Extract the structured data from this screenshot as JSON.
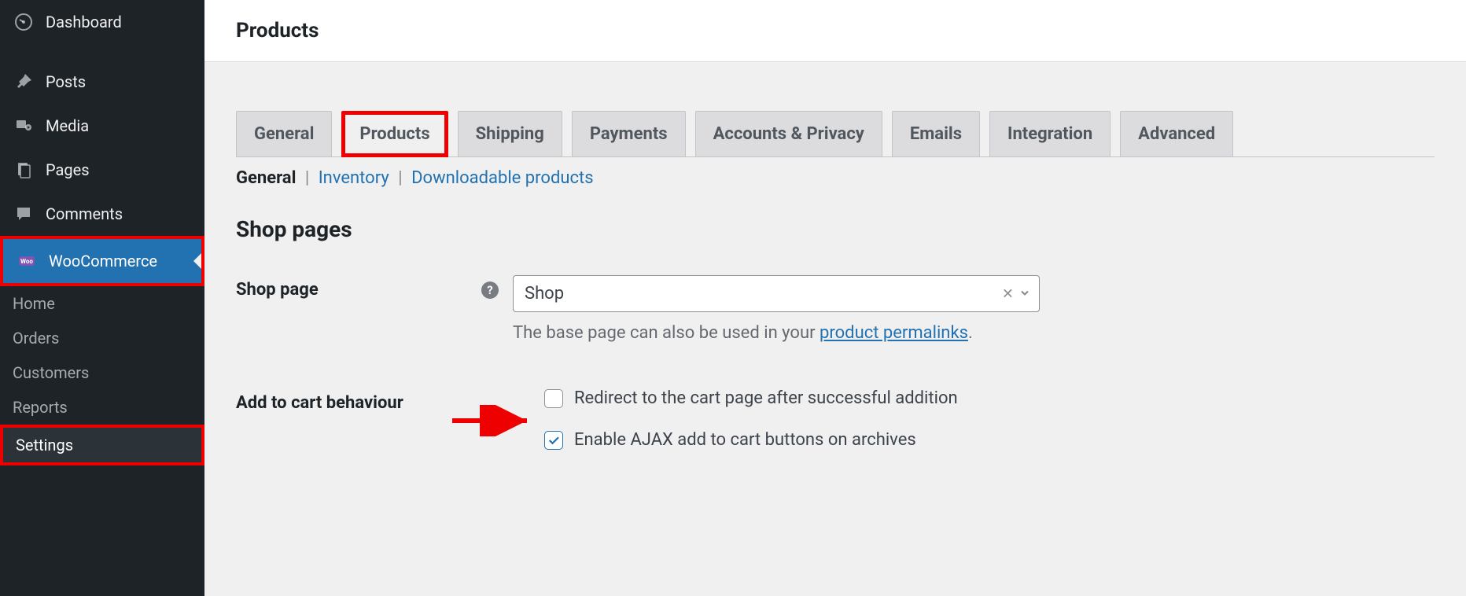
{
  "sidebar": {
    "dashboard": "Dashboard",
    "posts": "Posts",
    "media": "Media",
    "pages": "Pages",
    "comments": "Comments",
    "woocommerce": "WooCommerce",
    "submenu": {
      "home": "Home",
      "orders": "Orders",
      "customers": "Customers",
      "reports": "Reports",
      "settings": "Settings"
    }
  },
  "header": {
    "title": "Products"
  },
  "tabs": {
    "general": "General",
    "products": "Products",
    "shipping": "Shipping",
    "payments": "Payments",
    "accounts": "Accounts & Privacy",
    "emails": "Emails",
    "integration": "Integration",
    "advanced": "Advanced"
  },
  "subtabs": {
    "general": "General",
    "inventory": "Inventory",
    "downloadable": "Downloadable products"
  },
  "section": {
    "heading": "Shop pages",
    "shop_page_label": "Shop page",
    "shop_page_value": "Shop",
    "shop_page_help_pre": "The base page can also be used in your ",
    "shop_page_help_link": "product permalinks",
    "shop_page_help_post": ".",
    "cart_label": "Add to cart behaviour",
    "redirect_label": "Redirect to the cart page after successful addition",
    "ajax_label": "Enable AJAX add to cart buttons on archives"
  }
}
